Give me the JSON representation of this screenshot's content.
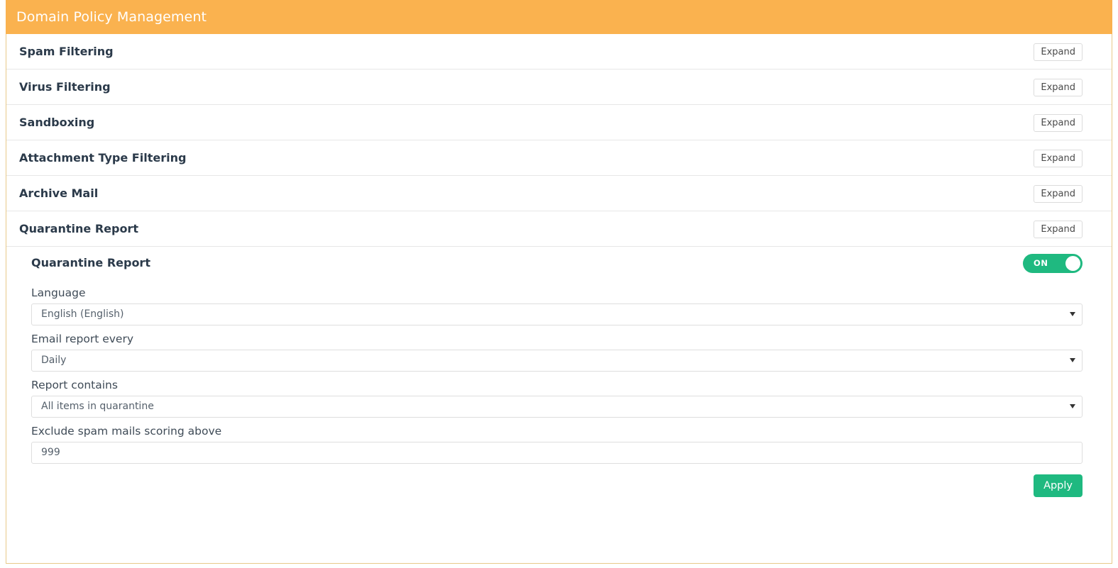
{
  "header": {
    "title": "Domain Policy Management",
    "background_color": "#fab24f",
    "text_color": "#ffffff"
  },
  "sections": [
    {
      "title": "Spam Filtering",
      "expand_label": "Expand",
      "expanded": false
    },
    {
      "title": "Virus Filtering",
      "expand_label": "Expand",
      "expanded": false
    },
    {
      "title": "Sandboxing",
      "expand_label": "Expand",
      "expanded": false
    },
    {
      "title": "Attachment Type Filtering",
      "expand_label": "Expand",
      "expanded": false
    },
    {
      "title": "Archive Mail",
      "expand_label": "Expand",
      "expanded": false
    },
    {
      "title": "Quarantine Report",
      "expand_label": "Expand",
      "expanded": true
    }
  ],
  "quarantine_report": {
    "sub_title": "Quarantine Report",
    "toggle": {
      "label": "ON",
      "state": "on",
      "on_color": "#1fb980"
    },
    "fields": {
      "language": {
        "label": "Language",
        "value": "English (English)",
        "type": "select",
        "caret": "chevron-down-icon"
      },
      "email_report_every": {
        "label": "Email report every",
        "value": "Daily",
        "type": "select",
        "caret": "chevron-down-icon"
      },
      "report_contains": {
        "label": "Report contains",
        "value": "All items in quarantine",
        "type": "select",
        "caret": "chevron-down-icon"
      },
      "exclude_spam_score": {
        "label": "Exclude spam mails scoring above",
        "value": "999",
        "type": "text"
      }
    },
    "apply_label": "Apply",
    "apply_color": "#1fb980"
  }
}
